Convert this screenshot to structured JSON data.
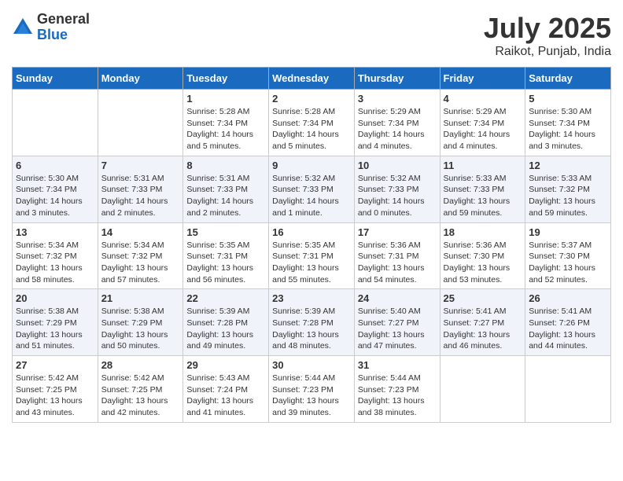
{
  "header": {
    "logo_line1": "General",
    "logo_line2": "Blue",
    "title": "July 2025",
    "subtitle": "Raikot, Punjab, India"
  },
  "weekdays": [
    "Sunday",
    "Monday",
    "Tuesday",
    "Wednesday",
    "Thursday",
    "Friday",
    "Saturday"
  ],
  "weeks": [
    [
      {
        "day": "",
        "info": ""
      },
      {
        "day": "",
        "info": ""
      },
      {
        "day": "1",
        "info": "Sunrise: 5:28 AM\nSunset: 7:34 PM\nDaylight: 14 hours and 5 minutes."
      },
      {
        "day": "2",
        "info": "Sunrise: 5:28 AM\nSunset: 7:34 PM\nDaylight: 14 hours and 5 minutes."
      },
      {
        "day": "3",
        "info": "Sunrise: 5:29 AM\nSunset: 7:34 PM\nDaylight: 14 hours and 4 minutes."
      },
      {
        "day": "4",
        "info": "Sunrise: 5:29 AM\nSunset: 7:34 PM\nDaylight: 14 hours and 4 minutes."
      },
      {
        "day": "5",
        "info": "Sunrise: 5:30 AM\nSunset: 7:34 PM\nDaylight: 14 hours and 3 minutes."
      }
    ],
    [
      {
        "day": "6",
        "info": "Sunrise: 5:30 AM\nSunset: 7:34 PM\nDaylight: 14 hours and 3 minutes."
      },
      {
        "day": "7",
        "info": "Sunrise: 5:31 AM\nSunset: 7:33 PM\nDaylight: 14 hours and 2 minutes."
      },
      {
        "day": "8",
        "info": "Sunrise: 5:31 AM\nSunset: 7:33 PM\nDaylight: 14 hours and 2 minutes."
      },
      {
        "day": "9",
        "info": "Sunrise: 5:32 AM\nSunset: 7:33 PM\nDaylight: 14 hours and 1 minute."
      },
      {
        "day": "10",
        "info": "Sunrise: 5:32 AM\nSunset: 7:33 PM\nDaylight: 14 hours and 0 minutes."
      },
      {
        "day": "11",
        "info": "Sunrise: 5:33 AM\nSunset: 7:33 PM\nDaylight: 13 hours and 59 minutes."
      },
      {
        "day": "12",
        "info": "Sunrise: 5:33 AM\nSunset: 7:32 PM\nDaylight: 13 hours and 59 minutes."
      }
    ],
    [
      {
        "day": "13",
        "info": "Sunrise: 5:34 AM\nSunset: 7:32 PM\nDaylight: 13 hours and 58 minutes."
      },
      {
        "day": "14",
        "info": "Sunrise: 5:34 AM\nSunset: 7:32 PM\nDaylight: 13 hours and 57 minutes."
      },
      {
        "day": "15",
        "info": "Sunrise: 5:35 AM\nSunset: 7:31 PM\nDaylight: 13 hours and 56 minutes."
      },
      {
        "day": "16",
        "info": "Sunrise: 5:35 AM\nSunset: 7:31 PM\nDaylight: 13 hours and 55 minutes."
      },
      {
        "day": "17",
        "info": "Sunrise: 5:36 AM\nSunset: 7:31 PM\nDaylight: 13 hours and 54 minutes."
      },
      {
        "day": "18",
        "info": "Sunrise: 5:36 AM\nSunset: 7:30 PM\nDaylight: 13 hours and 53 minutes."
      },
      {
        "day": "19",
        "info": "Sunrise: 5:37 AM\nSunset: 7:30 PM\nDaylight: 13 hours and 52 minutes."
      }
    ],
    [
      {
        "day": "20",
        "info": "Sunrise: 5:38 AM\nSunset: 7:29 PM\nDaylight: 13 hours and 51 minutes."
      },
      {
        "day": "21",
        "info": "Sunrise: 5:38 AM\nSunset: 7:29 PM\nDaylight: 13 hours and 50 minutes."
      },
      {
        "day": "22",
        "info": "Sunrise: 5:39 AM\nSunset: 7:28 PM\nDaylight: 13 hours and 49 minutes."
      },
      {
        "day": "23",
        "info": "Sunrise: 5:39 AM\nSunset: 7:28 PM\nDaylight: 13 hours and 48 minutes."
      },
      {
        "day": "24",
        "info": "Sunrise: 5:40 AM\nSunset: 7:27 PM\nDaylight: 13 hours and 47 minutes."
      },
      {
        "day": "25",
        "info": "Sunrise: 5:41 AM\nSunset: 7:27 PM\nDaylight: 13 hours and 46 minutes."
      },
      {
        "day": "26",
        "info": "Sunrise: 5:41 AM\nSunset: 7:26 PM\nDaylight: 13 hours and 44 minutes."
      }
    ],
    [
      {
        "day": "27",
        "info": "Sunrise: 5:42 AM\nSunset: 7:25 PM\nDaylight: 13 hours and 43 minutes."
      },
      {
        "day": "28",
        "info": "Sunrise: 5:42 AM\nSunset: 7:25 PM\nDaylight: 13 hours and 42 minutes."
      },
      {
        "day": "29",
        "info": "Sunrise: 5:43 AM\nSunset: 7:24 PM\nDaylight: 13 hours and 41 minutes."
      },
      {
        "day": "30",
        "info": "Sunrise: 5:44 AM\nSunset: 7:23 PM\nDaylight: 13 hours and 39 minutes."
      },
      {
        "day": "31",
        "info": "Sunrise: 5:44 AM\nSunset: 7:23 PM\nDaylight: 13 hours and 38 minutes."
      },
      {
        "day": "",
        "info": ""
      },
      {
        "day": "",
        "info": ""
      }
    ]
  ]
}
